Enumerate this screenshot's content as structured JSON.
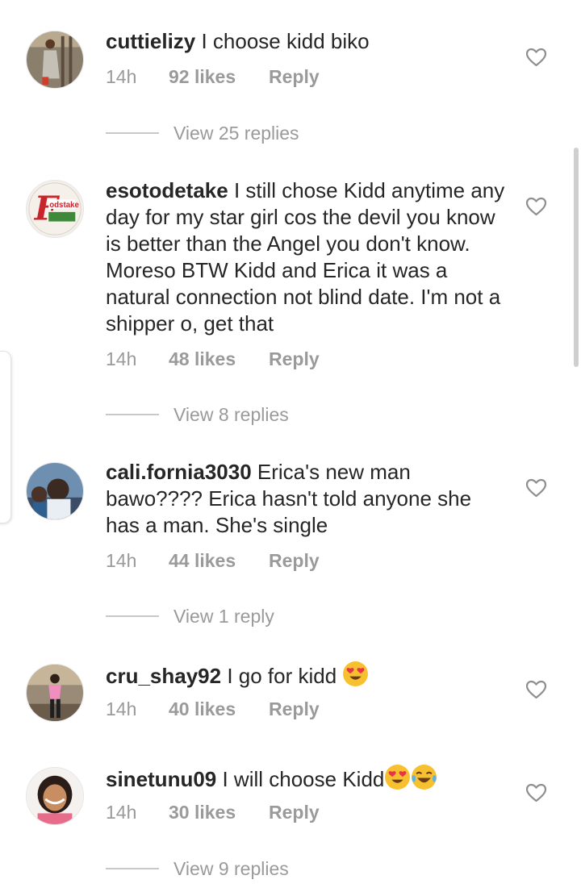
{
  "comments": [
    {
      "username": "cuttielizy",
      "text": "I choose kidd biko",
      "time": "14h",
      "likes": "92 likes",
      "reply": "Reply",
      "view_replies": "View 25 replies"
    },
    {
      "username": "esotodetake",
      "text": "I still chose Kidd anytime any day for my star girl cos the devil you know is better than the Angel you don't know. Moreso BTW Kidd and Erica it was a natural connection not blind date. I'm not a shipper o, get that",
      "time": "14h",
      "likes": "48 likes",
      "reply": "Reply",
      "view_replies": "View 8 replies",
      "avatar_text": "odstake"
    },
    {
      "username": "cali.fornia3030",
      "text": "Erica's new man bawo???? Erica hasn't told anyone she has a man. She's single",
      "time": "14h",
      "likes": "44 likes",
      "reply": "Reply",
      "view_replies": "View 1 reply"
    },
    {
      "username": "cru_shay92",
      "text": "I go for kidd",
      "emoji": [
        "heart-eyes-emoji"
      ],
      "time": "14h",
      "likes": "40 likes",
      "reply": "Reply"
    },
    {
      "username": "sinetunu09",
      "text": "I will choose Kidd",
      "emoji": [
        "heart-eyes-emoji",
        "tears-of-joy-emoji"
      ],
      "time": "14h",
      "likes": "30 likes",
      "reply": "Reply",
      "view_replies": "View 9 replies"
    }
  ],
  "icons": {
    "like": "heart-outline-icon"
  },
  "colors": {
    "text": "#262626",
    "meta": "#9a9a9a",
    "emoji_face": "#f7c02e",
    "emoji_heart": "#e8334a"
  }
}
